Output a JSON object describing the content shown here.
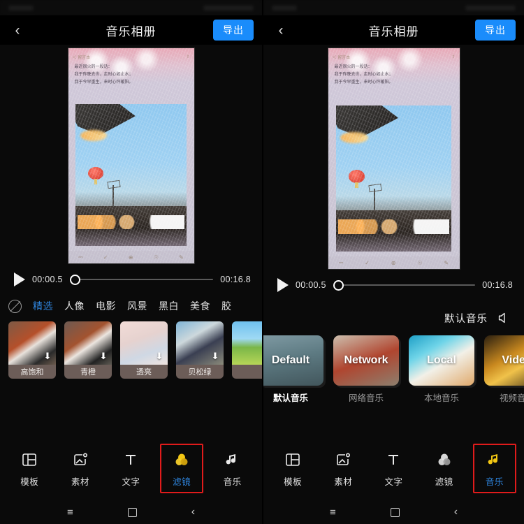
{
  "header": {
    "back_icon": "chevron-left-icon",
    "title": "音乐相册",
    "export_label": "导出",
    "export_color": "#1a8cfb"
  },
  "preview": {
    "top_back": "＜ 留言本",
    "share_icon": "share-icon",
    "text_lines": [
      "最近很火的一段话：",
      "我于昨晚去世，走时心如止水；",
      "我于今早重生，来时心怀暖阳。"
    ],
    "bottom_icons": [
      "trash-icon",
      "check-circle-icon",
      "plus-circle-icon",
      "star-circle-icon",
      "edit-icon"
    ]
  },
  "player": {
    "play_icon": "play-icon",
    "current_time": "00:00.5",
    "total_time": "00:16.8",
    "progress_percent": 3
  },
  "filter_panel": {
    "disable_icon": "no-filter-icon",
    "categories": [
      {
        "label": "精选",
        "active": true
      },
      {
        "label": "人像",
        "active": false
      },
      {
        "label": "电影",
        "active": false
      },
      {
        "label": "风景",
        "active": false
      },
      {
        "label": "黑白",
        "active": false
      },
      {
        "label": "美食",
        "active": false
      },
      {
        "label": "胶",
        "active": false
      }
    ],
    "thumbnails": [
      {
        "label": "高饱和",
        "download_icon": "download-arrow-icon"
      },
      {
        "label": "青橙",
        "download_icon": "download-arrow-icon"
      },
      {
        "label": "透亮",
        "download_icon": "download-arrow-icon"
      },
      {
        "label": "贝松绿",
        "download_icon": "download-arrow-icon"
      },
      {
        "label": "",
        "download_icon": "download-arrow-icon"
      }
    ]
  },
  "music_panel": {
    "header_label": "默认音乐",
    "speaker_icon": "speaker-icon",
    "items": [
      {
        "cover_text": "Default",
        "label": "默认音乐",
        "active": true
      },
      {
        "cover_text": "Network",
        "label": "网络音乐",
        "active": false
      },
      {
        "cover_text": "Local",
        "label": "本地音乐",
        "active": false
      },
      {
        "cover_text": "Video",
        "label": "视频音乐",
        "active": false
      }
    ]
  },
  "toolbar_left": {
    "items": [
      {
        "label": "模板",
        "icon": "template-icon",
        "active": false,
        "highlight": false
      },
      {
        "label": "素材",
        "icon": "material-image-icon",
        "active": false,
        "highlight": false
      },
      {
        "label": "文字",
        "icon": "text-icon",
        "active": false,
        "highlight": false
      },
      {
        "label": "滤镜",
        "icon": "filter-circles-icon",
        "active": true,
        "highlight": true
      },
      {
        "label": "音乐",
        "icon": "music-note-icon",
        "active": false,
        "highlight": false
      }
    ]
  },
  "toolbar_right": {
    "items": [
      {
        "label": "模板",
        "icon": "template-icon",
        "active": false,
        "highlight": false
      },
      {
        "label": "素材",
        "icon": "material-image-icon",
        "active": false,
        "highlight": false
      },
      {
        "label": "文字",
        "icon": "text-icon",
        "active": false,
        "highlight": false
      },
      {
        "label": "滤镜",
        "icon": "filter-circles-icon",
        "active": false,
        "highlight": false
      },
      {
        "label": "音乐",
        "icon": "music-note-icon",
        "active": true,
        "highlight": true
      }
    ]
  },
  "navbar": {
    "recent_icon": "recent-apps-icon",
    "home_icon": "home-square-icon",
    "back_icon": "nav-back-icon"
  },
  "colors": {
    "accent_blue": "#2f86e0",
    "highlight_red": "#e01b1b",
    "active_yellow": "#f5c518",
    "background": "#0a0a0a"
  }
}
